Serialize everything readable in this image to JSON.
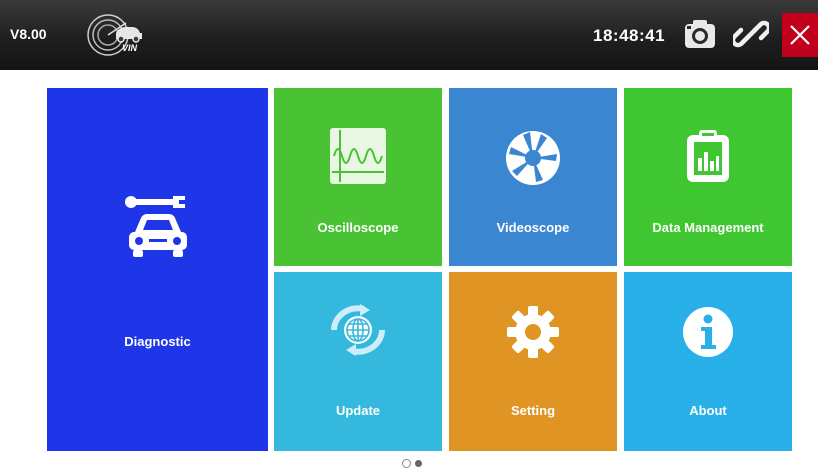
{
  "header": {
    "version": "V8.00",
    "vin_label": "VIN",
    "time": "18:48:41",
    "icons": [
      "vin-scan-icon",
      "camera-icon",
      "link-icon",
      "close-icon"
    ]
  },
  "tiles": [
    {
      "id": "diagnostic",
      "label": "Diagnostic",
      "color": "#1f36e8",
      "icon": "car-wrench-icon"
    },
    {
      "id": "oscilloscope",
      "label": "Oscilloscope",
      "color": "#49c333",
      "icon": "oscilloscope-icon"
    },
    {
      "id": "videoscope",
      "label": "Videoscope",
      "color": "#3a86d1",
      "icon": "aperture-icon"
    },
    {
      "id": "data-management",
      "label": "Data Management",
      "color": "#3fc631",
      "icon": "clipboard-chart-icon"
    },
    {
      "id": "update",
      "label": "Update",
      "color": "#34b8dd",
      "icon": "globe-refresh-icon"
    },
    {
      "id": "setting",
      "label": "Setting",
      "color": "#df9423",
      "icon": "gear-icon"
    },
    {
      "id": "about",
      "label": "About",
      "color": "#2ab0e9",
      "icon": "info-icon"
    }
  ],
  "pager": {
    "pages": 2,
    "current": 2
  },
  "colors": {
    "topbar": "#1f1f1f",
    "close": "#c0001b",
    "background": "#ffffff"
  }
}
